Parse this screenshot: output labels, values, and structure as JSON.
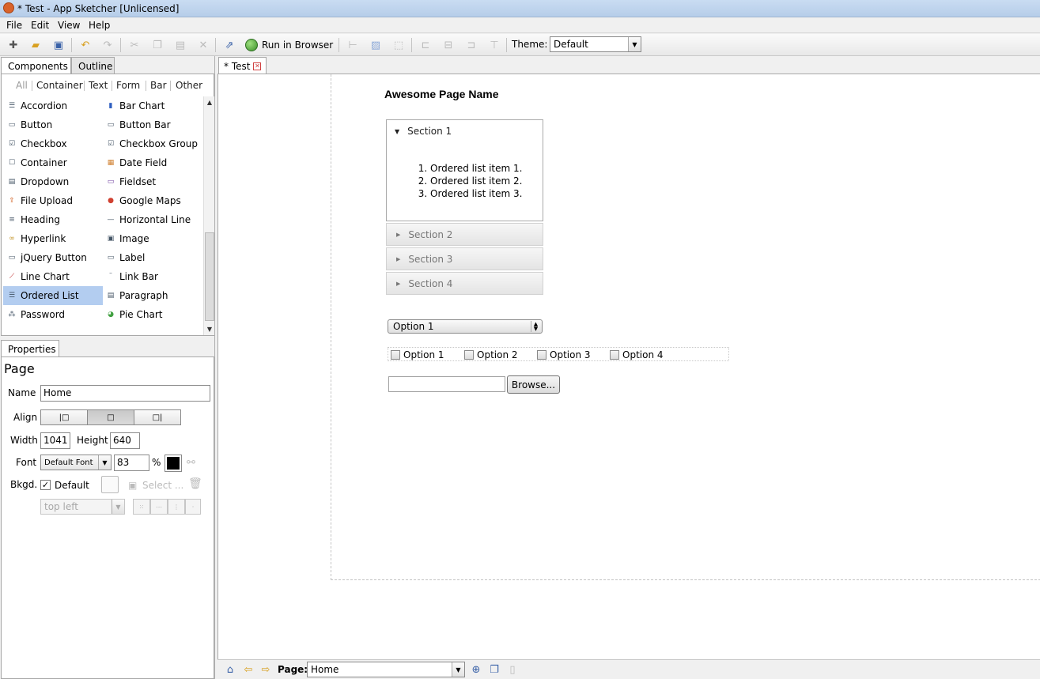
{
  "window": {
    "title": "* Test - App Sketcher [Unlicensed]"
  },
  "menu": [
    "File",
    "Edit",
    "View",
    "Help"
  ],
  "toolbar": {
    "run_label": "Run in Browser",
    "theme_label": "Theme:",
    "theme_value": "Default",
    "icons": [
      "new-file-icon",
      "open-folder-icon",
      "save-icon",
      "undo-icon",
      "redo-icon",
      "cut-icon",
      "copy-icon",
      "paste-icon",
      "delete-icon",
      "export-icon",
      "globe-icon",
      "tree-icon",
      "pattern-icon",
      "select-region-icon",
      "align-left-icon",
      "align-center-icon",
      "align-right-icon",
      "align-top-icon"
    ]
  },
  "left_tabs": {
    "components": "Components",
    "outline": "Outline"
  },
  "filters": [
    "All",
    "Container",
    "Text",
    "Form",
    "Bar",
    "Other"
  ],
  "components": {
    "left": [
      "Accordion",
      "Button",
      "Checkbox",
      "Container",
      "Dropdown",
      "File Upload",
      "Heading",
      "Hyperlink",
      "jQuery Button",
      "Line Chart",
      "Ordered List",
      "Password"
    ],
    "right": [
      "Bar Chart",
      "Button Bar",
      "Checkbox Group",
      "Date Field",
      "Fieldset",
      "Google Maps",
      "Horizontal Line",
      "Image",
      "Label",
      "Link Bar",
      "Paragraph",
      "Pie Chart"
    ],
    "selected": "Ordered List"
  },
  "properties": {
    "tab": "Properties",
    "heading": "Page",
    "name_label": "Name",
    "name_value": "Home",
    "align_label": "Align",
    "width_label": "Width",
    "width_value": "1041",
    "height_label": "Height",
    "height_value": "640",
    "font_label": "Font",
    "font_value": "Default Font",
    "font_size": "83",
    "percent": "%",
    "bkgd_label": "Bkgd.",
    "default_label": "Default",
    "select_label": "Select ...",
    "position_value": "top left"
  },
  "editor": {
    "tab": "* Test",
    "page_title": "Awesome Page Name",
    "sections": [
      "Section 1",
      "Section 2",
      "Section 3",
      "Section 4"
    ],
    "list_items": [
      "Ordered list item 1.",
      "Ordered list item 2.",
      "Ordered list item 3."
    ],
    "dropdown_value": "Option 1",
    "checkbox_options": [
      "Option 1",
      "Option 2",
      "Option 3",
      "Option 4"
    ],
    "browse_label": "Browse..."
  },
  "bottom": {
    "page_label": "Page:",
    "page_value": "Home"
  }
}
